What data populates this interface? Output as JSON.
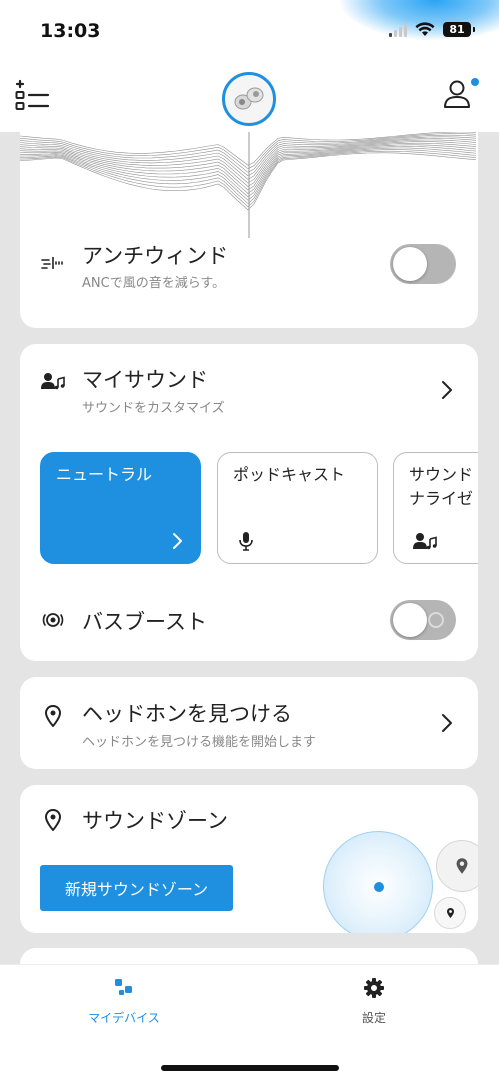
{
  "status_bar": {
    "time": "13:03",
    "battery": "81"
  },
  "colors": {
    "accent": "#1f8fe0",
    "toggle_off": "#b5b5b5",
    "background": "#e4e4e4"
  },
  "header": {
    "menu_icon": "list-settings-icon",
    "profile_icon": "person-icon",
    "device_image": "earbuds-image"
  },
  "anti_wind": {
    "title": "アンチウィンド",
    "subtitle": "ANCで風の音を減らす。",
    "enabled": false
  },
  "my_sound": {
    "title": "マイサウンド",
    "subtitle": "サウンドをカスタマイズ",
    "presets": [
      {
        "label": "ニュートラル",
        "selected": true
      },
      {
        "label": "ポッドキャスト",
        "icon": "microphone-icon"
      },
      {
        "label": "サウンド\nナライゼ",
        "icon": "person-music-icon"
      }
    ]
  },
  "bass_boost": {
    "title": "バスブースト",
    "enabled": false
  },
  "find_headphones": {
    "title": "ヘッドホンを見つける",
    "subtitle": "ヘッドホンを見つける機能を開始します"
  },
  "sound_zone": {
    "title": "サウンドゾーン",
    "new_zone_button": "新規サウンドゾーン"
  },
  "bottom_nav": {
    "items": [
      {
        "label": "マイデバイス",
        "active": true
      },
      {
        "label": "設定",
        "active": false
      }
    ]
  }
}
